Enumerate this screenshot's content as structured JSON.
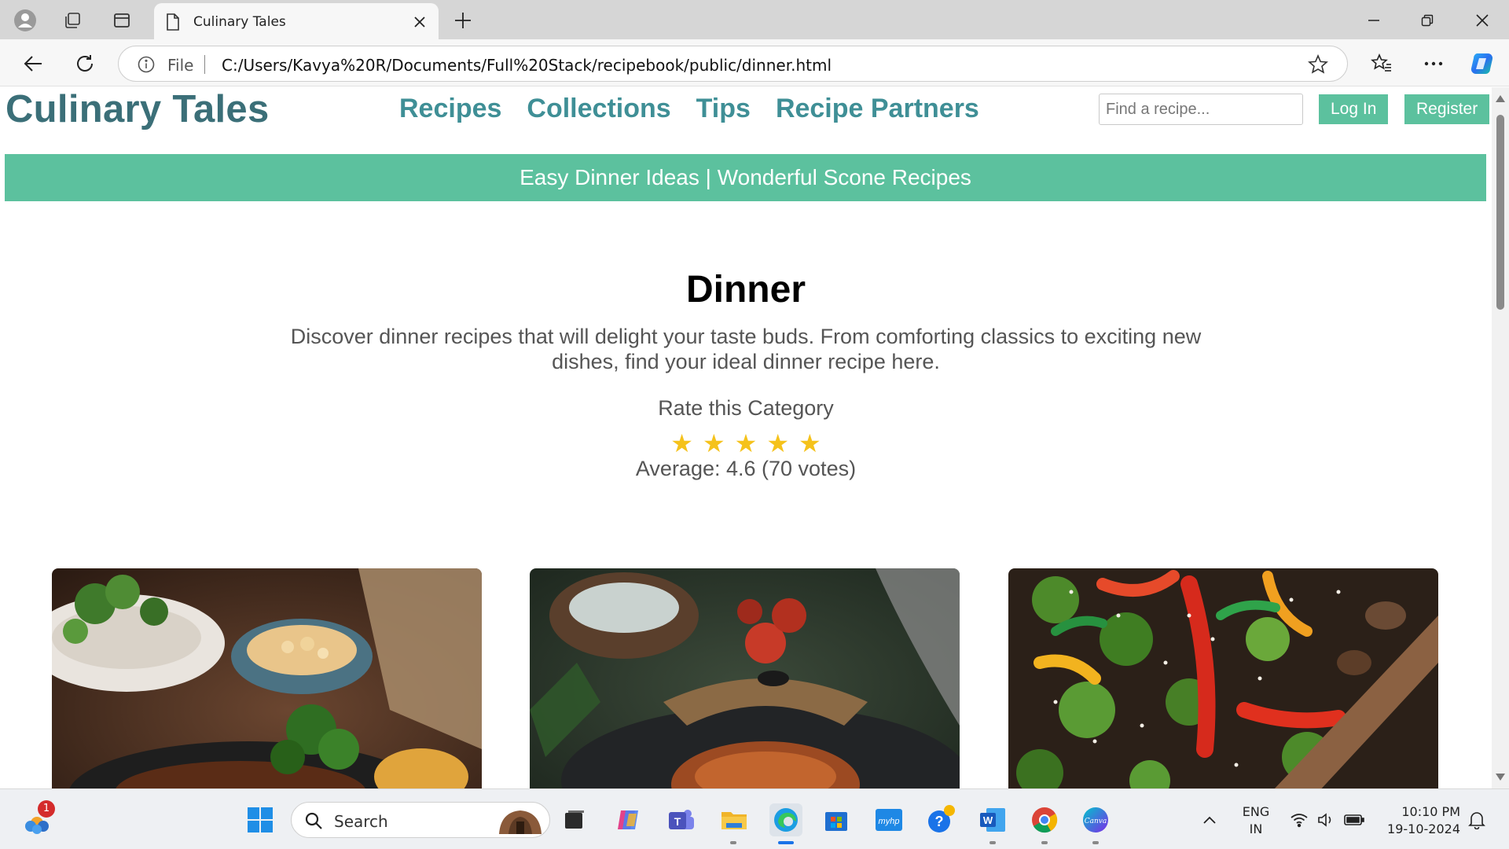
{
  "browser": {
    "tab_title": "Culinary Tales",
    "address_prefix": "File",
    "url": "C:/Users/Kavya%20R/Documents/Full%20Stack/recipebook/public/dinner.html"
  },
  "site": {
    "logo": "Culinary Tales",
    "nav": [
      "Recipes",
      "Collections",
      "Tips",
      "Recipe Partners"
    ],
    "search_placeholder": "Find a recipe...",
    "login_label": "Log In",
    "register_label": "Register",
    "banner_text": "Easy Dinner Ideas | Wonderful Scone Recipes",
    "accent_color": "#5cc19e",
    "brand_color": "#3b6f78"
  },
  "category": {
    "title": "Dinner",
    "description": "Discover dinner recipes that will delight your taste buds. From comforting classics to exciting new dishes, find your ideal dinner recipe here.",
    "rate_label": "Rate this Category",
    "stars_filled": 5,
    "star_color": "#f5c21b",
    "average_text": "Average: 4.6 (70 votes)"
  },
  "cards": [
    {
      "image": "grilled-meat-herbs-photo"
    },
    {
      "image": "salmon-skillet-photo"
    },
    {
      "image": "stir-fry-vegetables-photo"
    }
  ],
  "taskbar": {
    "search_label": "Search",
    "notification_count": "1",
    "lang_line1": "ENG",
    "lang_line2": "IN",
    "time": "10:10 PM",
    "date": "19-10-2024"
  }
}
